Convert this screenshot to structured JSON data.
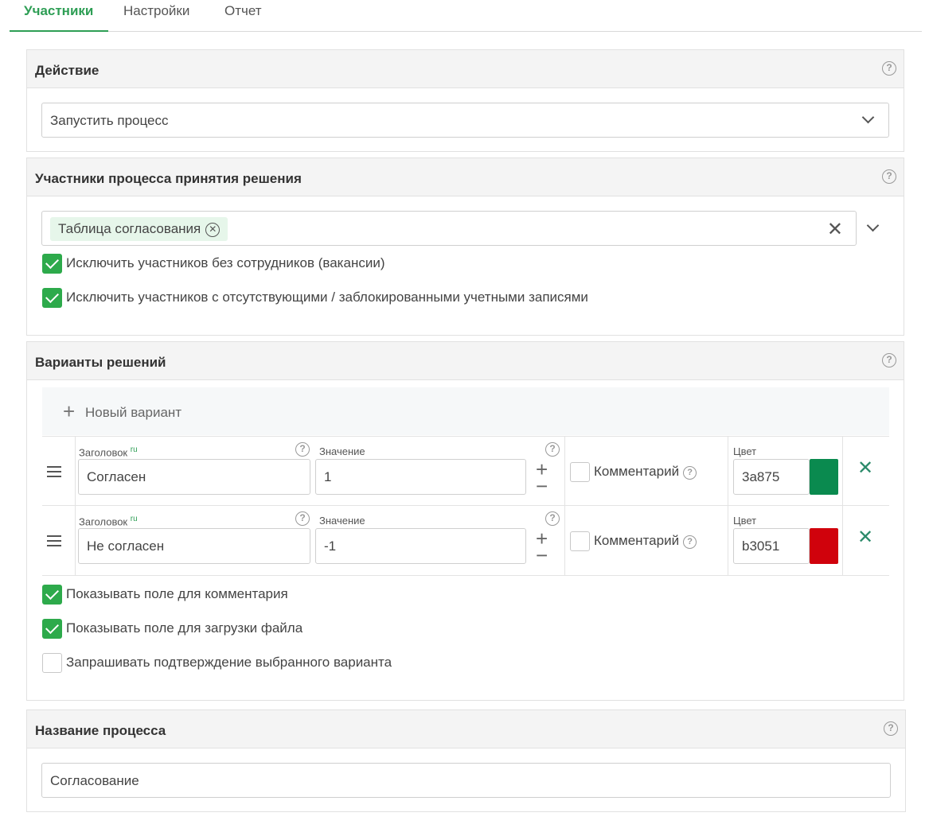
{
  "tabs": [
    {
      "label": "Участники"
    },
    {
      "label": "Настройки"
    },
    {
      "label": "Отчет"
    }
  ],
  "action": {
    "title": "Действие",
    "selected": "Запустить процесс"
  },
  "participants": {
    "title": "Участники процесса принятия решения",
    "tag": "Таблица согласования",
    "exclude_no_employees": "Исключить участников без сотрудников (вакансии)",
    "exclude_blocked": "Исключить участников с отсутствующими / заблокированными учетными записями"
  },
  "variants": {
    "title": "Варианты решений",
    "new_variant": "Новый вариант",
    "title_label": "Заголовок",
    "lang": "ru",
    "value_label": "Значение",
    "comment_label": "Комментарий",
    "color_label": "Цвет",
    "rows": [
      {
        "title": "Согласен",
        "value": "1",
        "color_text": "3a875",
        "color": "#0a8a4f"
      },
      {
        "title": "Не согласен",
        "value": "-1",
        "color_text": "b3051",
        "color": "#d0020c"
      }
    ],
    "show_comment": "Показывать поле для комментария",
    "show_upload": "Показывать поле для загрузки файла",
    "ask_confirm": "Запрашивать подтверждение выбранного варианта"
  },
  "process_name": {
    "title": "Название процесса",
    "value": "Согласование"
  }
}
